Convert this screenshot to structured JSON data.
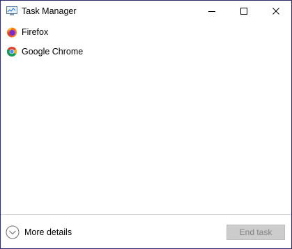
{
  "window": {
    "title": "Task Manager"
  },
  "titlebar_buttons": {
    "minimize_icon": "minimize-icon",
    "maximize_icon": "maximize-icon",
    "close_icon": "close-icon"
  },
  "processes": [
    {
      "name": "Firefox",
      "icon": "firefox-icon"
    },
    {
      "name": "Google Chrome",
      "icon": "chrome-icon"
    }
  ],
  "footer": {
    "more_details_label": "More details",
    "more_details_icon": "chevron-down-icon",
    "end_task_label": "End task",
    "end_task_enabled": false
  },
  "colors": {
    "window_border": "#2b2b6a",
    "end_task_bg": "#cccccc",
    "end_task_text": "#838383"
  }
}
